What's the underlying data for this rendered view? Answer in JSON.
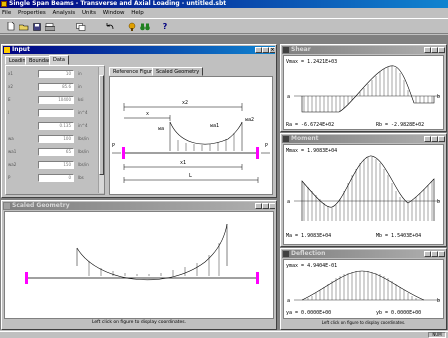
{
  "app": {
    "title": "Single Span Beams - Transverse and Axial Loading - untitled.sbt",
    "menu": [
      "File",
      "Properties",
      "Analysis",
      "Units",
      "Window",
      "Help"
    ],
    "toolbar_icons": [
      "new-icon",
      "open-icon",
      "save-icon",
      "print-icon",
      "copy-icon",
      "undo-icon",
      "wizard-icon",
      "binoculars-icon",
      "help-icon"
    ],
    "status": "NUM"
  },
  "input_window": {
    "title": "Input",
    "tabs": [
      "Loading",
      "Boundary",
      "Data"
    ],
    "active_tab": "Data",
    "fields": [
      {
        "label": "x1",
        "value": "10",
        "unit": "in"
      },
      {
        "label": "x2",
        "value": "85.6",
        "unit": "in"
      },
      {
        "label": "E",
        "value": "10400",
        "unit": "ksi"
      },
      {
        "label": "I",
        "value": "",
        "unit": "in^4"
      },
      {
        "label": "",
        "value": "0.135",
        "unit": "in^4"
      },
      {
        "label": "wa",
        "value": "100",
        "unit": "lbs/in"
      },
      {
        "label": "wa1",
        "value": "65",
        "unit": "lbs/in"
      },
      {
        "label": "wa2",
        "value": "150",
        "unit": "lbs/in"
      },
      {
        "label": "P",
        "value": "0",
        "unit": "lbs"
      }
    ],
    "figure_tabs": [
      "Reference Figure",
      "Scaled Geometry"
    ],
    "figure_labels": {
      "x2": "x2",
      "x": "x",
      "wa": "wa",
      "wa1": "wa1",
      "wa2": "wa2",
      "P_left": "P",
      "P_right": "P",
      "x1": "x1",
      "L": "L"
    }
  },
  "scaled_geometry": {
    "title": "Scaled Geometry",
    "hint": "Left click on figure to display coordinates."
  },
  "shear": {
    "title": "Shear",
    "max_label": "Vmax = 1.2421E+03",
    "left_label": "Ra = -6.6724E+02",
    "right_label": "Rb = -2.9828E+02",
    "a": "a",
    "b": "b"
  },
  "moment": {
    "title": "Moment",
    "max_label": "Mmax = 1.9083E+04",
    "left_label": "Ma = 1.9083E+04",
    "right_label": "Mb = 1.5403E+04",
    "a": "a",
    "b": "b"
  },
  "deflection": {
    "title": "Deflection",
    "max_label": "ymax = 4.9404E-01",
    "left_label": "ya = 0.0000E+00",
    "right_label": "yb = 0.0000E+00",
    "a": "a",
    "b": "b",
    "hint": "Left click on figure to display coordinates."
  }
}
